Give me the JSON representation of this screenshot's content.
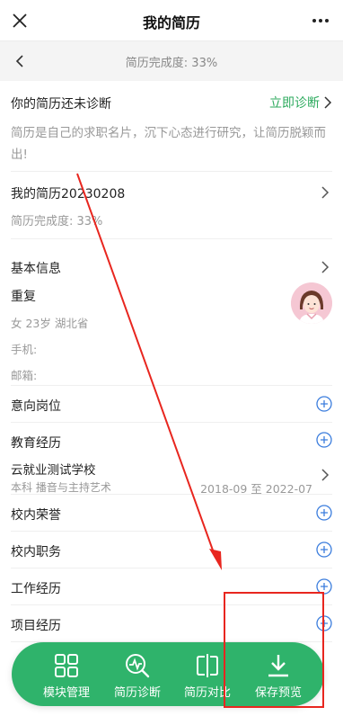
{
  "header": {
    "title": "我的简历",
    "close_icon": "close-icon",
    "more_icon": "more-icon"
  },
  "subheader": {
    "back_icon": "chevron-left-icon",
    "completion": "简历完成度: 33%"
  },
  "diagnosis": {
    "title": "你的简历还未诊断",
    "action": "立即诊断",
    "description": "简历是自己的求职名片，沉下心态进行研究，让简历脱颖而出!"
  },
  "resume": {
    "name": "我的简历20230208",
    "completion": "简历完成度: 33%"
  },
  "basic_info": {
    "heading": "基本信息",
    "user_name": "重复",
    "meta": "女  23岁  湖北省",
    "phone_label": "手机:",
    "email_label": "邮箱:"
  },
  "sections": {
    "intention": "意向岗位",
    "education": "教育经历",
    "honors": "校内荣誉",
    "positions": "校内职务",
    "work": "工作经历",
    "projects": "项目经历"
  },
  "education": {
    "school": "云就业测试学校",
    "major": "本科  播音与主持艺术",
    "dates": "2018-09 至 2022-07"
  },
  "bottom_tabs": [
    {
      "label": "模块管理",
      "icon": "grid-icon"
    },
    {
      "label": "简历诊断",
      "icon": "diagnosis-icon"
    },
    {
      "label": "简历对比",
      "icon": "compare-icon"
    },
    {
      "label": "保存预览",
      "icon": "download-icon"
    }
  ],
  "colors": {
    "accent_green": "#2fb36b",
    "annotation_red": "#e8261f",
    "plus_blue": "#3b7ddd"
  }
}
